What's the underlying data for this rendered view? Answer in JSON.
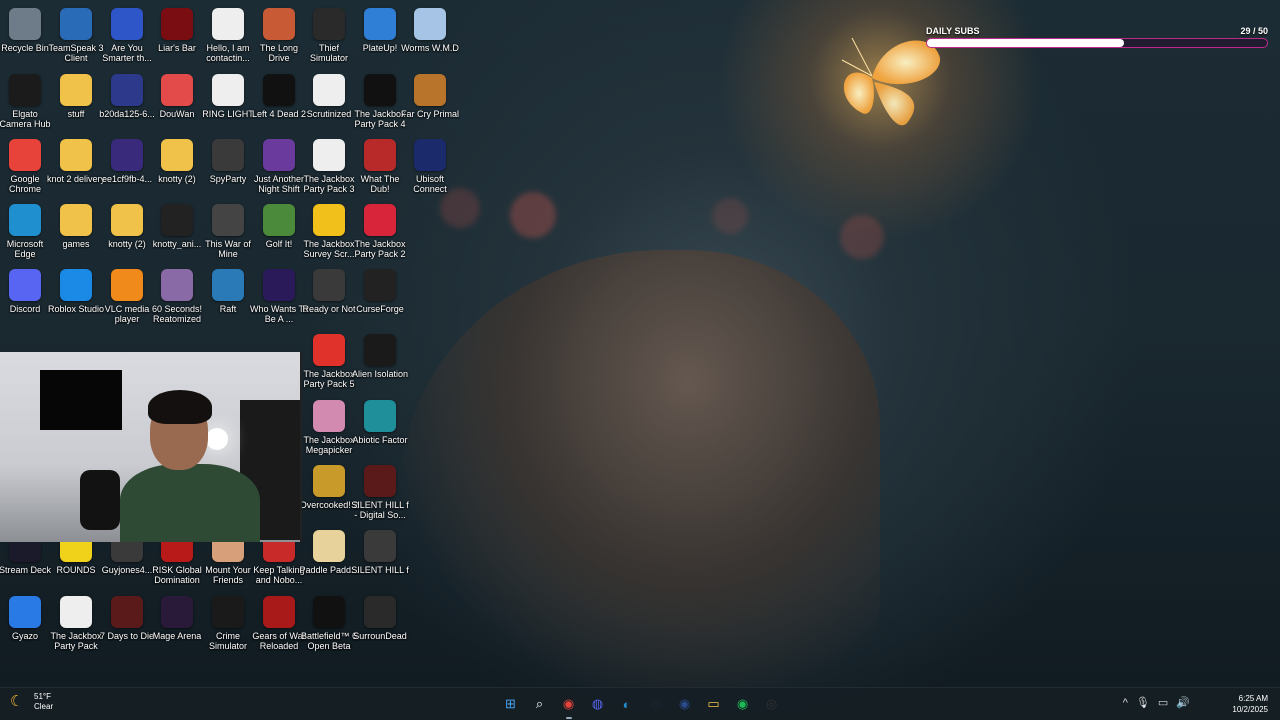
{
  "overlay": {
    "title": "DAILY SUBS",
    "current": 29,
    "goal": 50,
    "count_label": "29  / 50",
    "progress": 0.58
  },
  "desktop_icons": [
    {
      "label": "Recycle Bin",
      "icon": "recycle-bin-icon",
      "color": "#6d7c88"
    },
    {
      "label": "TeamSpeak 3 Client",
      "icon": "teamspeak-icon",
      "color": "#2a6bb8"
    },
    {
      "label": "Are You Smarter th...",
      "icon": "game-icon",
      "color": "#2f56c8"
    },
    {
      "label": "Liar's Bar",
      "icon": "game-icon",
      "color": "#7a0d12"
    },
    {
      "label": "Hello, I am contactin...",
      "icon": "document-icon",
      "color": "#eeeeee"
    },
    {
      "label": "The Long Drive",
      "icon": "car-icon",
      "color": "#c85b35"
    },
    {
      "label": "Thief Simulator",
      "icon": "game-icon",
      "color": "#2a2a2a"
    },
    {
      "label": "PlateUp!",
      "icon": "game-icon",
      "color": "#2f7fd6"
    },
    {
      "label": "Worms W.M.D",
      "icon": "game-icon",
      "color": "#a6c4e6"
    },
    {
      "label": "Elgato Camera Hub",
      "icon": "camera-icon",
      "color": "#1b1b1b"
    },
    {
      "label": "stuff",
      "icon": "folder-icon",
      "color": "#f1c24a"
    },
    {
      "label": "b20da125-6...",
      "icon": "file-icon",
      "color": "#2d3a8c"
    },
    {
      "label": "DouWan",
      "icon": "app-icon",
      "color": "#e34a4a"
    },
    {
      "label": "RING LIGHT",
      "icon": "document-icon",
      "color": "#eeeeee"
    },
    {
      "label": "Left 4 Dead 2",
      "icon": "game-icon",
      "color": "#111111"
    },
    {
      "label": "Scrutinized",
      "icon": "document-icon",
      "color": "#eeeeee"
    },
    {
      "label": "The Jackbox Party Pack 4",
      "icon": "game-icon",
      "color": "#111111"
    },
    {
      "label": "Far Cry Primal",
      "icon": "game-icon",
      "color": "#b8742a"
    },
    {
      "label": "Google Chrome",
      "icon": "chrome-icon",
      "color": "#e7433a"
    },
    {
      "label": "knot 2 delivery",
      "icon": "folder-icon",
      "color": "#f1c24a"
    },
    {
      "label": "ee1cf9fb-4...",
      "icon": "file-icon",
      "color": "#3a2a7c"
    },
    {
      "label": "knotty (2)",
      "icon": "folder-icon",
      "color": "#f1c24a"
    },
    {
      "label": "SpyParty",
      "icon": "game-icon",
      "color": "#3a3a3a"
    },
    {
      "label": "Just Another Night Shift",
      "icon": "game-icon",
      "color": "#6a3a9c"
    },
    {
      "label": "The Jackbox Party Pack 3",
      "icon": "game-icon",
      "color": "#eeeeee"
    },
    {
      "label": "What The Dub!",
      "icon": "game-icon",
      "color": "#b82a2a"
    },
    {
      "label": "Ubisoft Connect",
      "icon": "ubisoft-icon",
      "color": "#1a2a6a"
    },
    {
      "label": "Microsoft Edge",
      "icon": "edge-icon",
      "color": "#1f8fcf"
    },
    {
      "label": "games",
      "icon": "folder-icon",
      "color": "#f1c24a"
    },
    {
      "label": "knotty (2)",
      "icon": "folder-icon",
      "color": "#f1c24a"
    },
    {
      "label": "knotty_ani...",
      "icon": "video-icon",
      "color": "#222222"
    },
    {
      "label": "This War of Mine",
      "icon": "game-icon",
      "color": "#444444"
    },
    {
      "label": "Golf It!",
      "icon": "game-icon",
      "color": "#4a8a3a"
    },
    {
      "label": "The Jackbox Survey Scr...",
      "icon": "game-icon",
      "color": "#f2c01a"
    },
    {
      "label": "The Jackbox Party Pack 2",
      "icon": "game-icon",
      "color": "#d8253a"
    },
    {
      "label": "Discord",
      "icon": "discord-icon",
      "color": "#5865f2"
    },
    {
      "label": "Roblox Studio",
      "icon": "roblox-icon",
      "color": "#1a8ae6"
    },
    {
      "label": "VLC media player",
      "icon": "vlc-icon",
      "color": "#f08a1a"
    },
    {
      "label": "60 Seconds! Reatomized",
      "icon": "game-icon",
      "color": "#8a6aa6"
    },
    {
      "label": "Raft",
      "icon": "game-icon",
      "color": "#2a7ab8"
    },
    {
      "label": "Who Wants To Be A ...",
      "icon": "game-icon",
      "color": "#2a1a5a"
    },
    {
      "label": "Ready or Not",
      "icon": "game-icon",
      "color": "#3a3a3a"
    },
    {
      "label": "CurseForge",
      "icon": "curseforge-icon",
      "color": "#222222"
    },
    {
      "label": "The Jackbox Party Pack 5",
      "icon": "game-icon",
      "color": "#e0322a"
    },
    {
      "label": "Alien Isolation",
      "icon": "game-icon",
      "color": "#1a1a1a"
    },
    {
      "label": "The Jackbox Megapicker",
      "icon": "game-icon",
      "color": "#d28ab0"
    },
    {
      "label": "Abiotic Factor",
      "icon": "game-icon",
      "color": "#1f8f9a"
    },
    {
      "label": "Overcooked! 2",
      "icon": "game-icon",
      "color": "#c89a2a"
    },
    {
      "label": "SILENT HILL f - Digital So...",
      "icon": "game-icon",
      "color": "#5a1a1a"
    },
    {
      "label": "Stream Deck",
      "icon": "stream-deck-icon",
      "color": "#1a1a2a"
    },
    {
      "label": "ROUNDS",
      "icon": "game-icon",
      "color": "#f0d21a"
    },
    {
      "label": "Guyjones4...",
      "icon": "file-icon",
      "color": "#3a3a3a"
    },
    {
      "label": "RISK Global Domination",
      "icon": "game-icon",
      "color": "#b81a1a"
    },
    {
      "label": "Mount Your Friends",
      "icon": "game-icon",
      "color": "#d8a07a"
    },
    {
      "label": "Keep Talking and Nobo...",
      "icon": "game-icon",
      "color": "#c82a2a"
    },
    {
      "label": "Paddle Padd...",
      "icon": "game-icon",
      "color": "#e6d29a"
    },
    {
      "label": "SILENT HILL f",
      "icon": "game-icon",
      "color": "#3a3a3a"
    },
    {
      "label": "Gyazo",
      "icon": "gyazo-icon",
      "color": "#2a7ae6"
    },
    {
      "label": "The Jackbox Party Pack",
      "icon": "game-icon",
      "color": "#eeeeee"
    },
    {
      "label": "7 Days to Die",
      "icon": "game-icon",
      "color": "#5a1a1a"
    },
    {
      "label": "Mage Arena",
      "icon": "game-icon",
      "color": "#2a1a3a"
    },
    {
      "label": "Crime Simulator",
      "icon": "game-icon",
      "color": "#1a1a1a"
    },
    {
      "label": "Gears of War Reloaded",
      "icon": "game-icon",
      "color": "#a81a1a"
    },
    {
      "label": "Battlefield™ 6 Open Beta",
      "icon": "game-icon",
      "color": "#111111"
    },
    {
      "label": "SurrounDead",
      "icon": "game-icon",
      "color": "#2a2a2a"
    }
  ],
  "taskbar": {
    "weather_temp": "51°F",
    "weather_cond": "Clear",
    "time": "6:25 AM",
    "date": "10/2/2025",
    "apps": [
      {
        "name": "start",
        "glyph": "⊞",
        "color": "#4aa0f0"
      },
      {
        "name": "search",
        "glyph": "⌕",
        "color": "#ffffff"
      },
      {
        "name": "chrome",
        "glyph": "◉",
        "color": "#e7433a"
      },
      {
        "name": "discord",
        "glyph": "◍",
        "color": "#5865f2"
      },
      {
        "name": "edge",
        "glyph": "◐",
        "color": "#1f8fcf"
      },
      {
        "name": "steam",
        "glyph": "◎",
        "color": "#1b2838"
      },
      {
        "name": "steam-alt",
        "glyph": "◉",
        "color": "#2a4a8a"
      },
      {
        "name": "file-explorer",
        "glyph": "▭",
        "color": "#f1c24a"
      },
      {
        "name": "spotify",
        "glyph": "◉",
        "color": "#1db954"
      },
      {
        "name": "obs",
        "glyph": "◎",
        "color": "#333333"
      }
    ],
    "tray": [
      "^",
      "🎙",
      "▭",
      "🔊"
    ]
  }
}
